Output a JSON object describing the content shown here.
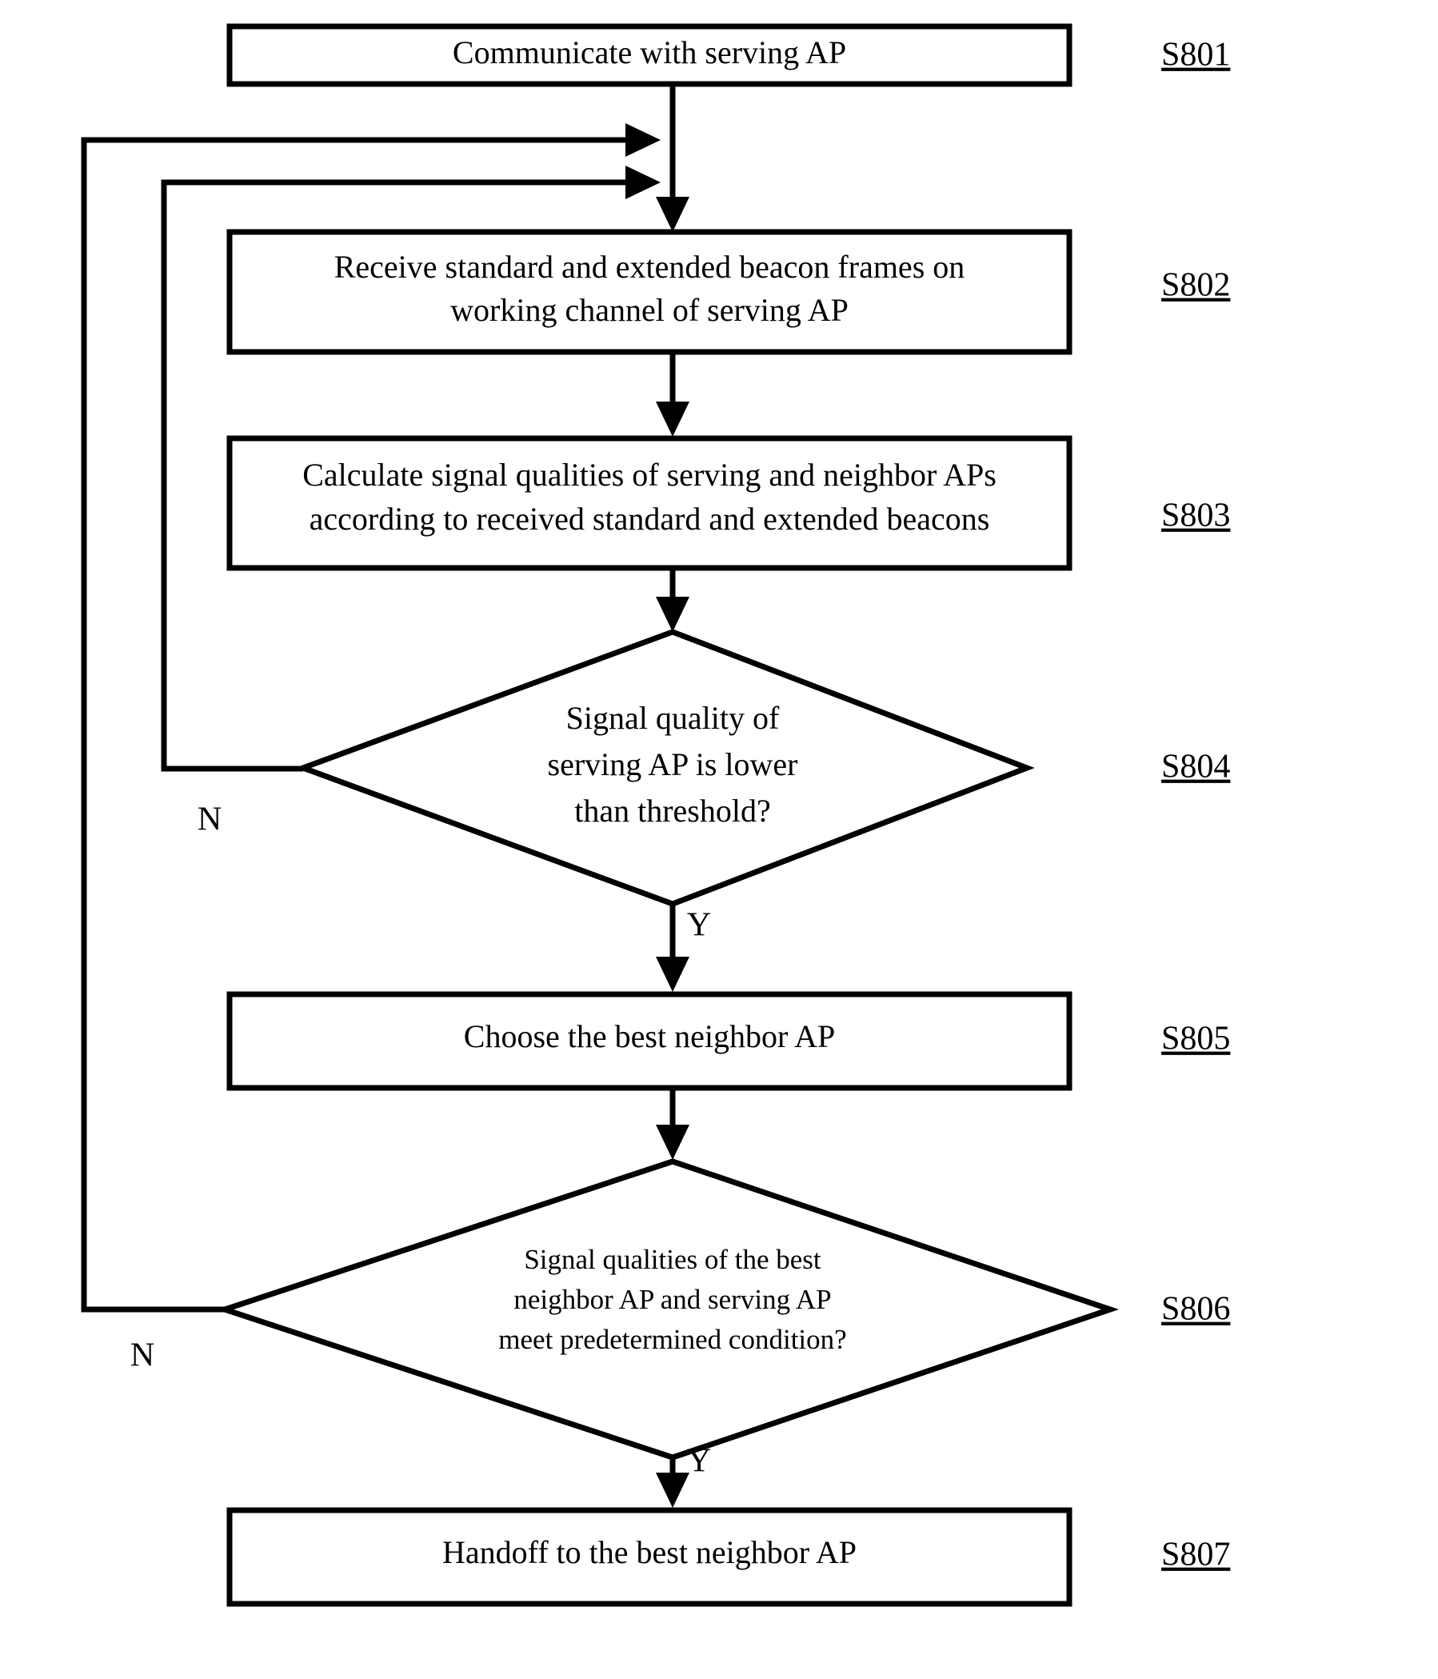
{
  "figure": {
    "type": "flowchart",
    "orientation": "top-to-bottom",
    "background_color": "#ffffff",
    "line_color": "#000000"
  },
  "nodes": [
    {
      "id": "S801",
      "shape": "process",
      "lines": [
        "Communicate with serving AP"
      ],
      "step_label": "S801"
    },
    {
      "id": "S802",
      "shape": "process",
      "lines": [
        "Receive standard and extended beacon frames on",
        "working channel of serving AP"
      ],
      "step_label": "S802"
    },
    {
      "id": "S803",
      "shape": "process",
      "lines": [
        "Calculate signal qualities of serving and neighbor APs",
        "according to received standard and extended beacons"
      ],
      "step_label": "S803"
    },
    {
      "id": "S804",
      "shape": "decision",
      "lines": [
        "Signal quality of",
        "serving AP is lower",
        "than threshold?"
      ],
      "step_label": "S804"
    },
    {
      "id": "S805",
      "shape": "process",
      "lines": [
        "Choose the best neighbor AP"
      ],
      "step_label": "S805"
    },
    {
      "id": "S806",
      "shape": "decision",
      "lines": [
        "Signal qualities of the best",
        "neighbor AP and serving AP",
        "meet predetermined condition?"
      ],
      "step_label": "S806"
    },
    {
      "id": "S807",
      "shape": "process",
      "lines": [
        "Handoff to the best neighbor AP"
      ],
      "step_label": "S807"
    }
  ],
  "branch_labels": {
    "s804_no": "N",
    "s804_yes": "Y",
    "s806_no": "N",
    "s806_yes": "Y"
  },
  "text": {
    "node_0_line_0": "Communicate with serving AP",
    "node_1_line_0": "Receive standard and extended beacon frames on",
    "node_1_line_1": "working channel of serving AP",
    "node_2_line_0": "Calculate signal qualities of serving and neighbor APs",
    "node_2_line_1": "according to received standard and extended beacons",
    "node_3_line_0": "Signal quality of",
    "node_3_line_1": "serving AP is lower",
    "node_3_line_2": "than threshold?",
    "node_4_line_0": "Choose the best neighbor AP",
    "node_5_line_0": "Signal qualities of the best",
    "node_5_line_1": "neighbor AP and serving AP",
    "node_5_line_2": "meet predetermined condition?",
    "node_6_line_0": "Handoff to the best neighbor AP"
  },
  "labels": {
    "s801": "S801",
    "s802": "S802",
    "s803": "S803",
    "s804": "S804",
    "s805": "S805",
    "s806": "S806",
    "s807": "S807"
  }
}
